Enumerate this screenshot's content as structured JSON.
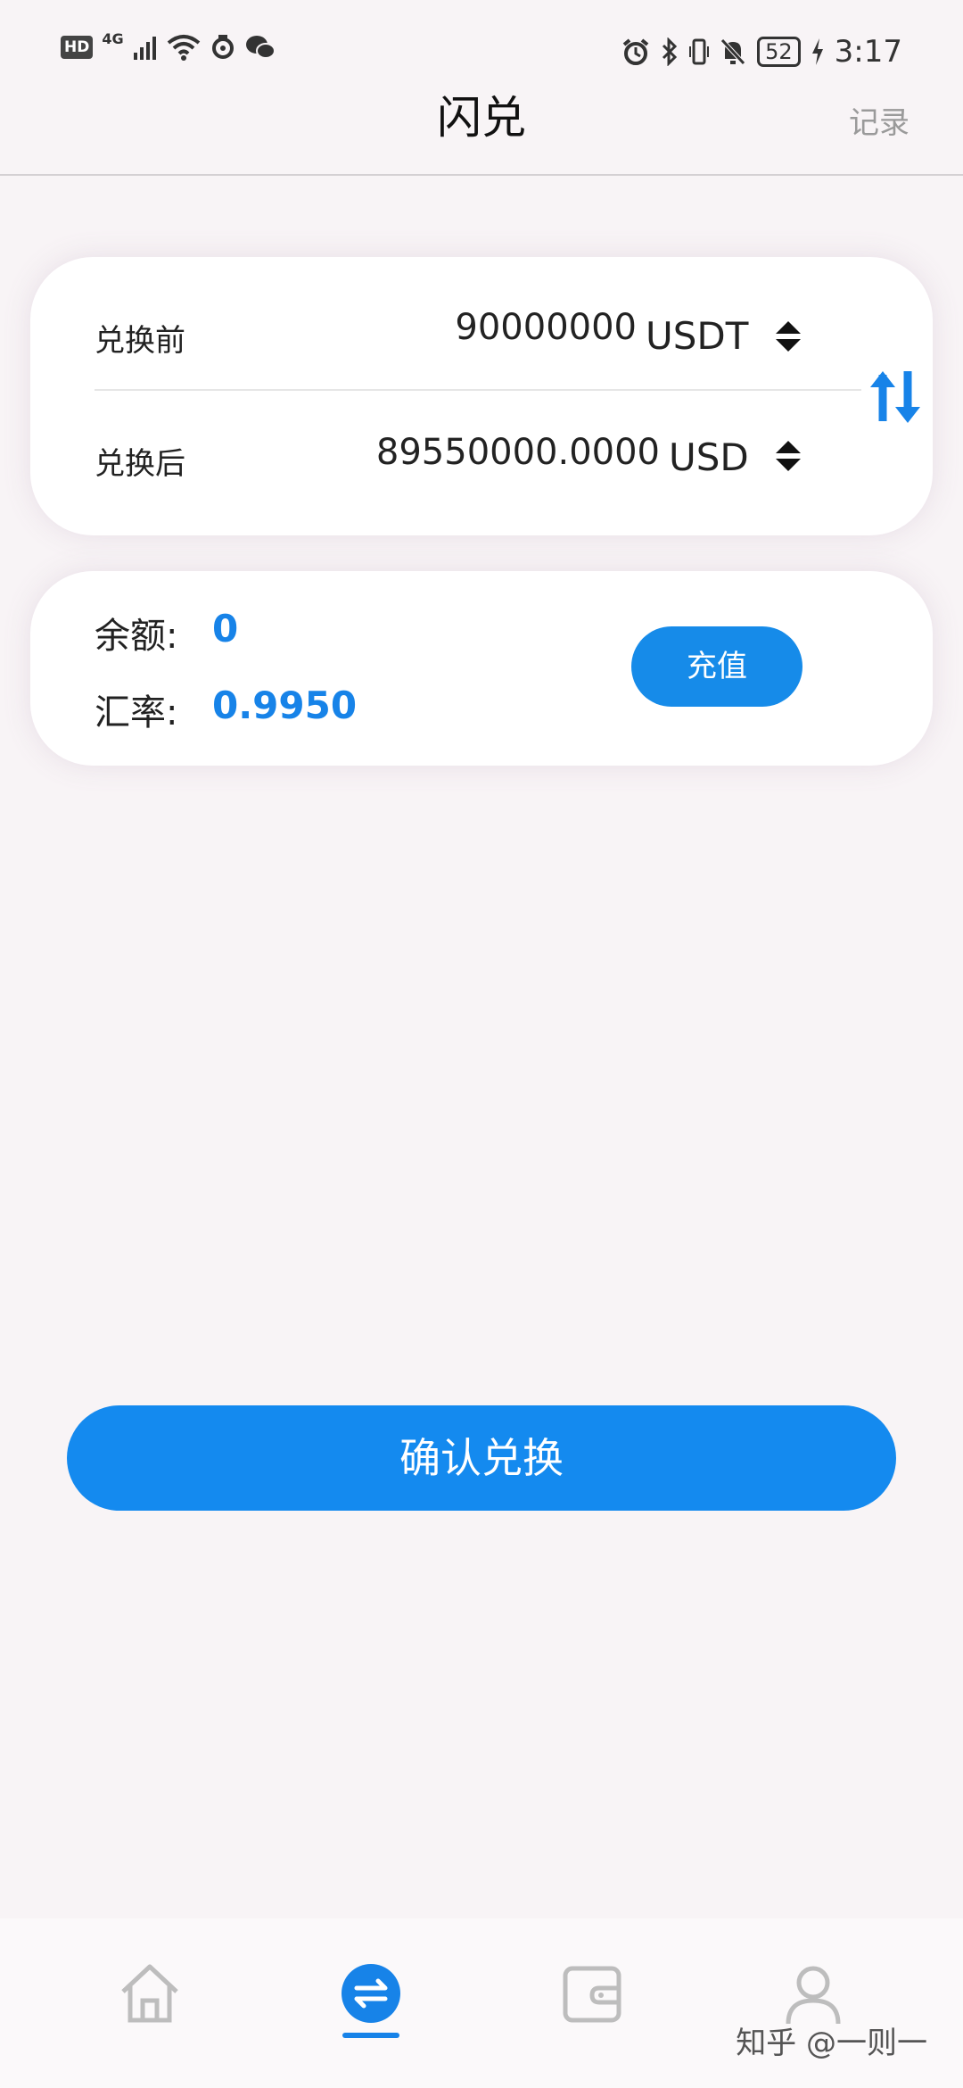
{
  "status_bar": {
    "left_icons": [
      "hd-icon",
      "signal-4g-icon",
      "wifi-icon",
      "sync-icon",
      "wechat-icon"
    ],
    "hd_label": "HD",
    "network": "4G",
    "right_icons": [
      "alarm-icon",
      "bluetooth-icon",
      "vibrate-icon",
      "mute-bell-icon",
      "battery-icon",
      "charging-icon"
    ],
    "battery": "52",
    "time": "3:17"
  },
  "header": {
    "title": "闪兑",
    "records_label": "记录"
  },
  "exchange_card": {
    "before_label": "兑换前",
    "before_amount": "90000000",
    "before_currency": "USDT",
    "after_label": "兑换后",
    "after_amount": "89550000.0000",
    "after_currency": "USD",
    "swap_icon": "swap-vertical-icon"
  },
  "info_card": {
    "balance_label": "余额:",
    "balance_value": "0",
    "rate_label": "汇率:",
    "rate_value": "0.9950",
    "recharge_label": "充值"
  },
  "confirm_label": "确认兑换",
  "bottom_nav": {
    "items": [
      {
        "name": "home",
        "icon": "home-icon",
        "active": false
      },
      {
        "name": "exchange",
        "icon": "exchange-icon",
        "active": true
      },
      {
        "name": "wallet",
        "icon": "wallet-icon",
        "active": false
      },
      {
        "name": "profile",
        "icon": "user-icon",
        "active": false
      }
    ]
  },
  "watermark": "知乎 @一则一",
  "colors": {
    "accent": "#1783e8",
    "background": "#f8f4f6",
    "card": "#ffffff",
    "muted_text": "#9a9a9a"
  }
}
